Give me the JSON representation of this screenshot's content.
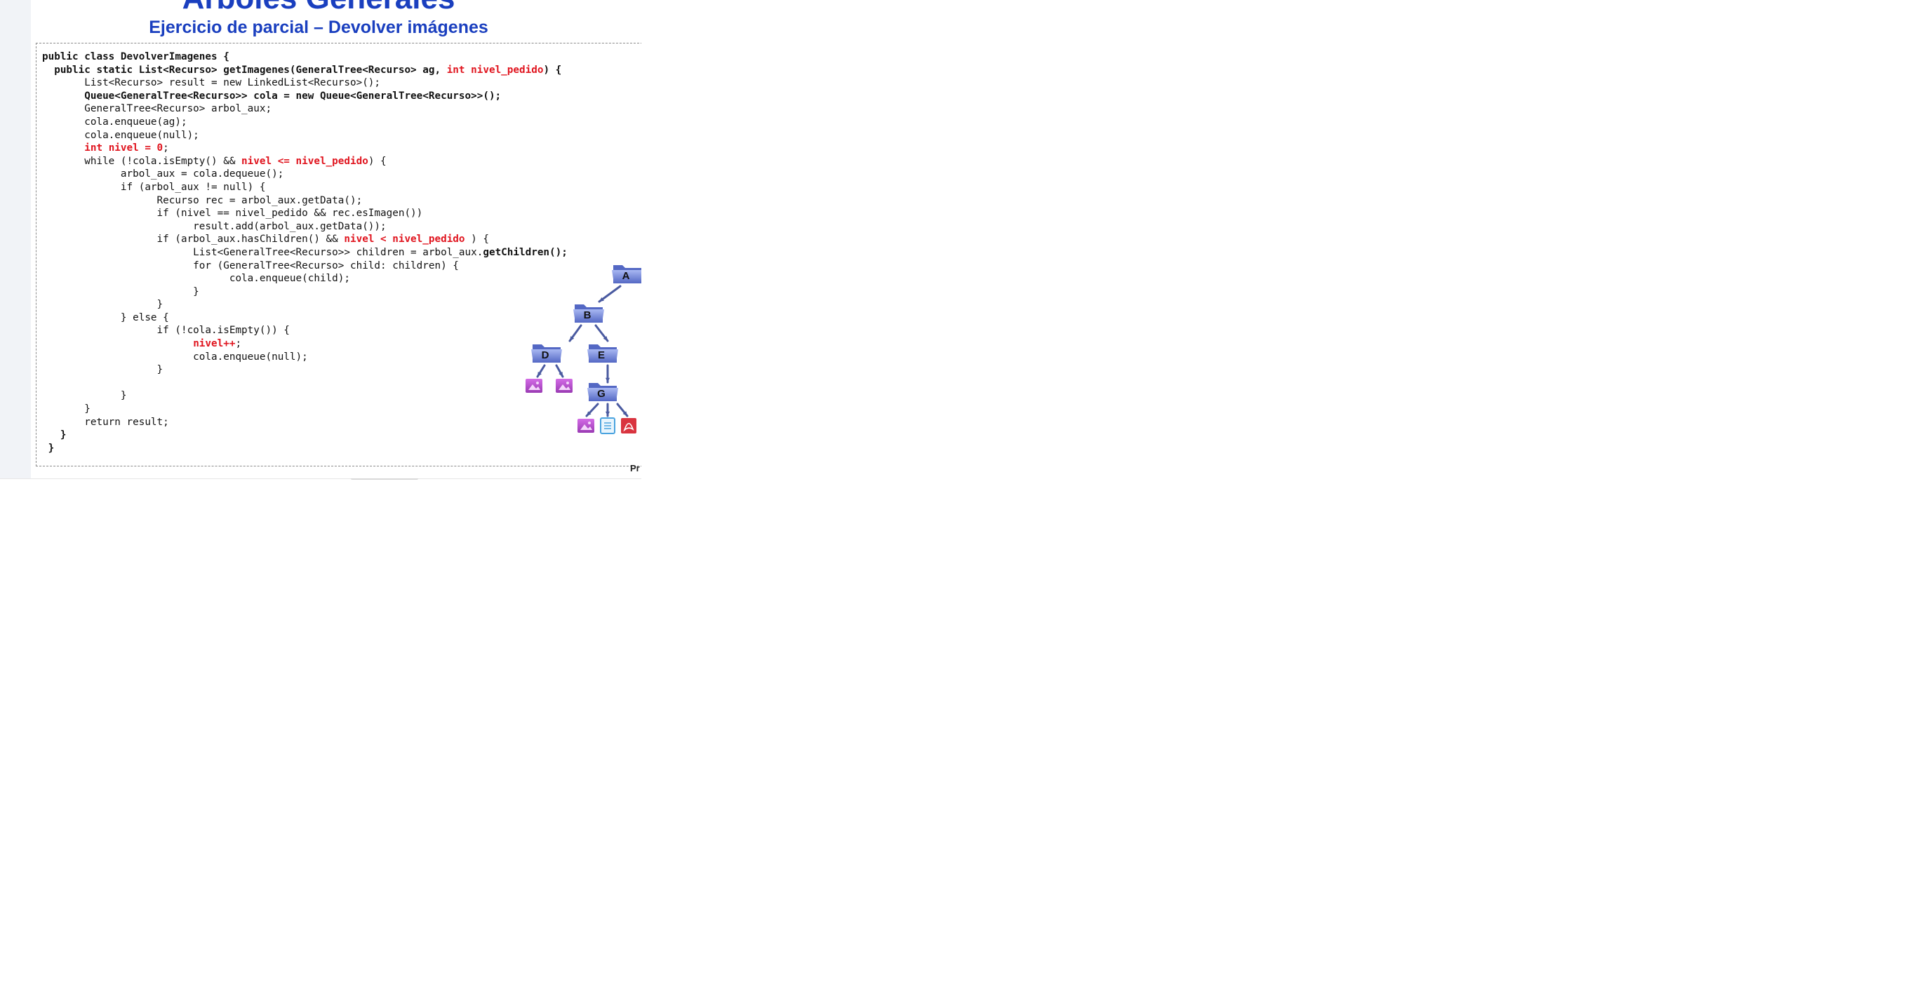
{
  "slide": {
    "title": "Árboles Generales",
    "subtitle": "Ejercicio de parcial – Devolver imágenes",
    "footer": "Pr"
  },
  "code": [
    [
      [
        "public class DevolverImagenes {",
        "b"
      ]
    ],
    [
      [
        "  public static List<Recurso> getImagenes(GeneralTree<Recurso> ag, ",
        "b"
      ],
      [
        "int nivel_pedido",
        "hl"
      ],
      [
        ") {",
        "b"
      ]
    ],
    [
      [
        "       List<Recurso> result = new LinkedList<Recurso>();",
        ""
      ]
    ],
    [
      [
        "       Queue<GeneralTree<Recurso>> cola = new Queue<GeneralTree<Recurso>>();",
        "b"
      ]
    ],
    [
      [
        "       GeneralTree<Recurso> arbol_aux;",
        ""
      ]
    ],
    [
      [
        "       cola.enqueue(ag);",
        ""
      ]
    ],
    [
      [
        "       cola.enqueue(null);",
        ""
      ]
    ],
    [
      [
        "       ",
        ""
      ],
      [
        "int nivel = 0",
        "hl"
      ],
      [
        ";",
        ""
      ]
    ],
    [
      [
        "       while (!cola.isEmpty() && ",
        ""
      ],
      [
        "nivel <= nivel_pedido",
        "hl"
      ],
      [
        ") {",
        ""
      ]
    ],
    [
      [
        "             arbol_aux = cola.dequeue();",
        ""
      ]
    ],
    [
      [
        "             if (arbol_aux != null) {",
        ""
      ]
    ],
    [
      [
        "                   Recurso rec = arbol_aux.getData();",
        ""
      ]
    ],
    [
      [
        "                   if (nivel == nivel_pedido && rec.esImagen())",
        ""
      ]
    ],
    [
      [
        "                         result.add(arbol_aux.getData());",
        ""
      ]
    ],
    [
      [
        "                   if (arbol_aux.hasChildren() && ",
        ""
      ],
      [
        "nivel < nivel_pedido",
        "hl"
      ],
      [
        " ) {",
        ""
      ]
    ],
    [
      [
        "                         List<GeneralTree<Recurso>> children = arbol_aux.",
        ""
      ],
      [
        "getChildren();",
        "b"
      ]
    ],
    [
      [
        "                         for (GeneralTree<Recurso> child: children) {",
        ""
      ]
    ],
    [
      [
        "                               cola.enqueue(child);",
        ""
      ]
    ],
    [
      [
        "                         }",
        ""
      ]
    ],
    [
      [
        "                   }",
        ""
      ]
    ],
    [
      [
        "             } else {",
        ""
      ]
    ],
    [
      [
        "                   if (!cola.isEmpty()) {",
        ""
      ]
    ],
    [
      [
        "                         ",
        ""
      ],
      [
        "nivel++",
        "hl"
      ],
      [
        ";",
        ""
      ]
    ],
    [
      [
        "                         cola.enqueue(null);",
        ""
      ]
    ],
    [
      [
        "                   }",
        ""
      ]
    ],
    [
      [
        "",
        ""
      ]
    ],
    [
      [
        "             }",
        ""
      ]
    ],
    [
      [
        "       }",
        ""
      ]
    ],
    [
      [
        "       return result;",
        ""
      ]
    ],
    [
      [
        "   }",
        "b"
      ]
    ],
    [
      [
        " }",
        "b"
      ]
    ]
  ],
  "tree": {
    "nodes": {
      "A": "A",
      "B": "B",
      "D": "D",
      "E": "E",
      "G": "G"
    },
    "colors": {
      "folder": "#7b8fe0",
      "folder_dark": "#5468c4",
      "image_file": "#b24fc9",
      "doc_file": "#4aa3df",
      "pdf_file": "#d9343f",
      "edge": "#4a5aa0"
    },
    "icons": {
      "folder": "folder-icon",
      "image": "image-file-icon",
      "document": "document-file-icon",
      "pdf": "pdf-file-icon"
    }
  }
}
